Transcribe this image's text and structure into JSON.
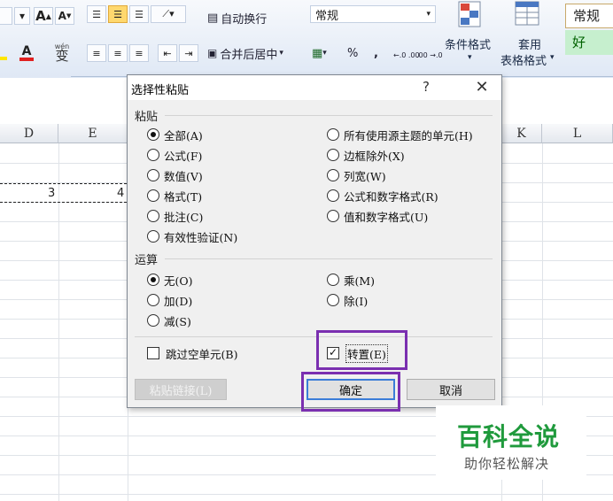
{
  "ribbon": {
    "font_size_dropdown_arrow": "▾",
    "increase_font": "A",
    "decrease_font": "A",
    "font_color_letter": "A",
    "phonetic": "wén",
    "phonetic_char": "变",
    "wrap_text": "自动换行",
    "merge_center": "合并后居中",
    "number_format_value": "常规",
    "percent": "%",
    "comma": ",",
    "inc_decimal": "←.0 .00",
    "dec_decimal": ".00 →.0",
    "conditional_format": "条件格式",
    "format_as_table_line1": "套用",
    "format_as_table_line2": "表格格式",
    "style_normal": "常规",
    "style_good": "好",
    "colors": {
      "font_color": "#e02020",
      "highlight": "#ffe600",
      "good_bg": "#c6efce",
      "good_text": "#006100"
    }
  },
  "sheet": {
    "columns": [
      "D",
      "E",
      "K",
      "L"
    ],
    "cells": [
      {
        "value": "3"
      },
      {
        "value": "4"
      }
    ]
  },
  "dialog": {
    "title": "选择性粘贴",
    "help": "?",
    "close": "✕",
    "paste_group": "粘贴",
    "paste_options": [
      {
        "label": "全部(A)",
        "selected": true
      },
      {
        "label": "公式(F)",
        "selected": false
      },
      {
        "label": "数值(V)",
        "selected": false
      },
      {
        "label": "格式(T)",
        "selected": false
      },
      {
        "label": "批注(C)",
        "selected": false
      },
      {
        "label": "有效性验证(N)",
        "selected": false
      },
      {
        "label": "所有使用源主题的单元(H)",
        "selected": false
      },
      {
        "label": "边框除外(X)",
        "selected": false
      },
      {
        "label": "列宽(W)",
        "selected": false
      },
      {
        "label": "公式和数字格式(R)",
        "selected": false
      },
      {
        "label": "值和数字格式(U)",
        "selected": false
      }
    ],
    "operation_group": "运算",
    "operation_options": [
      {
        "label": "无(O)",
        "selected": true
      },
      {
        "label": "加(D)",
        "selected": false
      },
      {
        "label": "减(S)",
        "selected": false
      },
      {
        "label": "乘(M)",
        "selected": false
      },
      {
        "label": "除(I)",
        "selected": false
      }
    ],
    "skip_blanks": {
      "label": "跳过空单元(B)",
      "checked": false
    },
    "transpose": {
      "label": "转置(E)",
      "checked": true,
      "mark": "✓"
    },
    "paste_link": "粘贴链接(L)",
    "ok": "确定",
    "cancel": "取消",
    "highlight_color": "#7a2fb0"
  },
  "watermark": {
    "title": "百科全说",
    "subtitle": "助你轻松解决"
  }
}
